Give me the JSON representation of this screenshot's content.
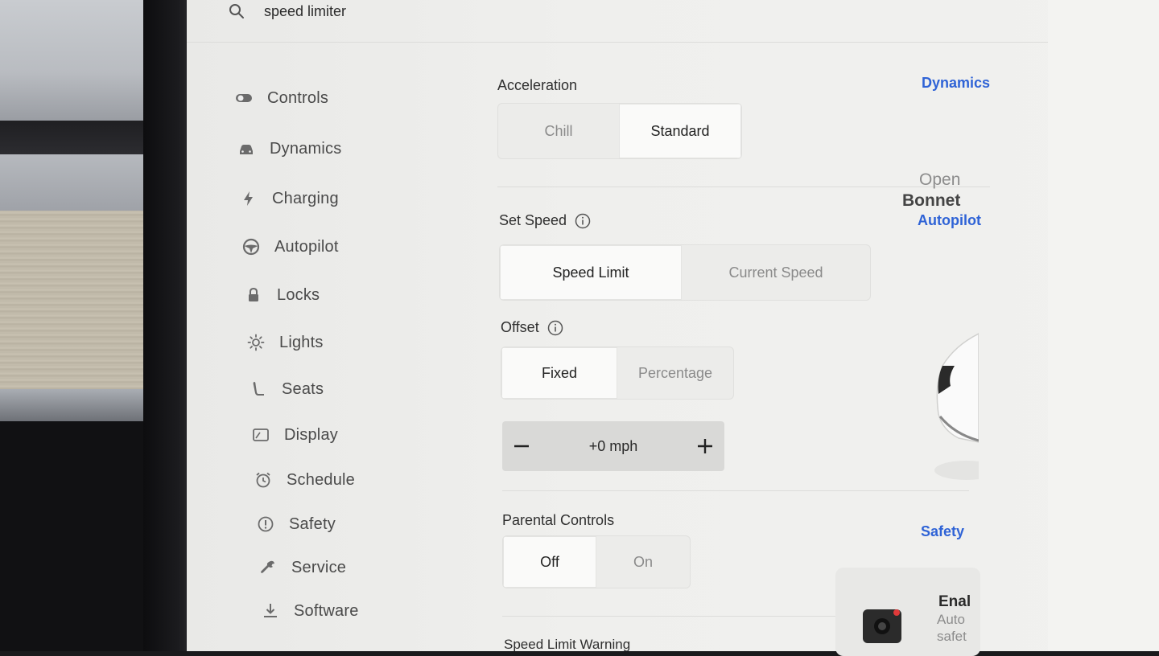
{
  "search": {
    "value": "speed limiter"
  },
  "sidebar": {
    "items": [
      {
        "label": "Controls",
        "icon": "toggle-icon"
      },
      {
        "label": "Dynamics",
        "icon": "car-icon"
      },
      {
        "label": "Charging",
        "icon": "lightning-icon"
      },
      {
        "label": "Autopilot",
        "icon": "steering-wheel-icon"
      },
      {
        "label": "Locks",
        "icon": "lock-icon"
      },
      {
        "label": "Lights",
        "icon": "sun-icon"
      },
      {
        "label": "Seats",
        "icon": "seat-icon"
      },
      {
        "label": "Display",
        "icon": "display-icon"
      },
      {
        "label": "Schedule",
        "icon": "clock-icon"
      },
      {
        "label": "Safety",
        "icon": "alert-circle-icon"
      },
      {
        "label": "Service",
        "icon": "wrench-icon"
      },
      {
        "label": "Software",
        "icon": "download-icon"
      }
    ]
  },
  "acceleration": {
    "title": "Acceleration",
    "link": "Dynamics",
    "options": [
      "Chill",
      "Standard"
    ],
    "selected": "Standard"
  },
  "set_speed": {
    "title": "Set Speed",
    "link": "Autopilot",
    "options": [
      "Speed Limit",
      "Current Speed"
    ],
    "selected": "Speed Limit"
  },
  "offset": {
    "title": "Offset",
    "options": [
      "Fixed",
      "Percentage"
    ],
    "selected": "Fixed",
    "value": "+0 mph"
  },
  "parental": {
    "title": "Parental Controls",
    "link": "Safety",
    "options": [
      "Off",
      "On"
    ],
    "selected": "Off"
  },
  "speed_limit_warning": {
    "title": "Speed Limit Warning"
  },
  "right_panel": {
    "open_label": "Open",
    "bonnet_label": "Bonnet",
    "enable_title": "Enal",
    "enable_sub1": "Auto",
    "enable_sub2": "safet"
  },
  "colors": {
    "accent": "#2f63d6",
    "background": "#f0f0ee"
  }
}
